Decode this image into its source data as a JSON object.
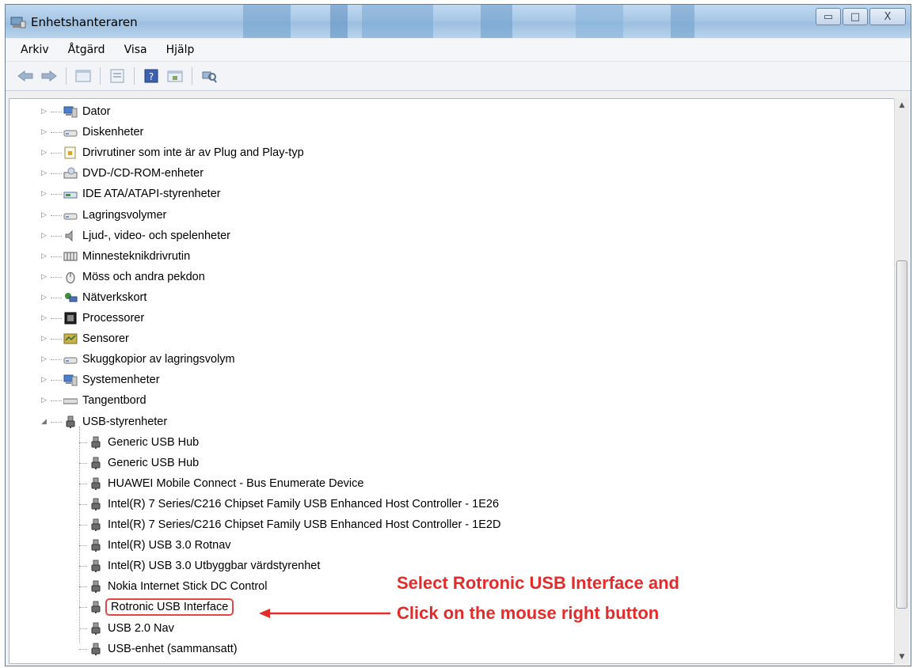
{
  "window": {
    "title": "Enhetshanteraren"
  },
  "caption_buttons": {
    "minimize": "▭",
    "maximize": "□",
    "close": "X"
  },
  "menu": [
    "Arkiv",
    "Åtgärd",
    "Visa",
    "Hjälp"
  ],
  "tree": {
    "categories": [
      {
        "label": "Dator",
        "icon": "computer-icon"
      },
      {
        "label": "Diskenheter",
        "icon": "disk-drive-icon"
      },
      {
        "label": "Drivrutiner som inte är av Plug and Play-typ",
        "icon": "driver-icon"
      },
      {
        "label": "DVD-/CD-ROM-enheter",
        "icon": "dvd-drive-icon"
      },
      {
        "label": "IDE ATA/ATAPI-styrenheter",
        "icon": "ide-controller-icon"
      },
      {
        "label": "Lagringsvolymer",
        "icon": "storage-volume-icon"
      },
      {
        "label": "Ljud-, video- och spelenheter",
        "icon": "speaker-icon"
      },
      {
        "label": "Minnesteknikdrivrutin",
        "icon": "memory-icon"
      },
      {
        "label": "Möss och andra pekdon",
        "icon": "mouse-icon"
      },
      {
        "label": "Nätverkskort",
        "icon": "network-card-icon"
      },
      {
        "label": "Processorer",
        "icon": "processor-icon"
      },
      {
        "label": "Sensorer",
        "icon": "sensor-icon"
      },
      {
        "label": "Skuggkopior av lagringsvolym",
        "icon": "shadow-copy-icon"
      },
      {
        "label": "Systemenheter",
        "icon": "system-device-icon"
      },
      {
        "label": "Tangentbord",
        "icon": "keyboard-icon"
      },
      {
        "label": "USB-styrenheter",
        "icon": "usb-icon"
      }
    ],
    "usb_children": [
      "Generic USB Hub",
      "Generic USB Hub",
      "HUAWEI Mobile Connect - Bus Enumerate Device",
      "Intel(R) 7 Series/C216 Chipset Family USB Enhanced Host Controller - 1E26",
      "Intel(R) 7 Series/C216 Chipset Family USB Enhanced Host Controller - 1E2D",
      "Intel(R) USB 3.0 Rotnav",
      "Intel(R) USB 3.0 Utbyggbar värdstyrenhet",
      "Nokia Internet Stick DC Control",
      "Rotronic USB Interface",
      "USB 2.0 Nav",
      "USB-enhet (sammansatt)"
    ],
    "highlighted": "Rotronic USB Interface"
  },
  "annotation": {
    "line1": "Select Rotronic USB Interface and",
    "line2": "Click on the mouse right button",
    "color": "#e32b2b"
  }
}
